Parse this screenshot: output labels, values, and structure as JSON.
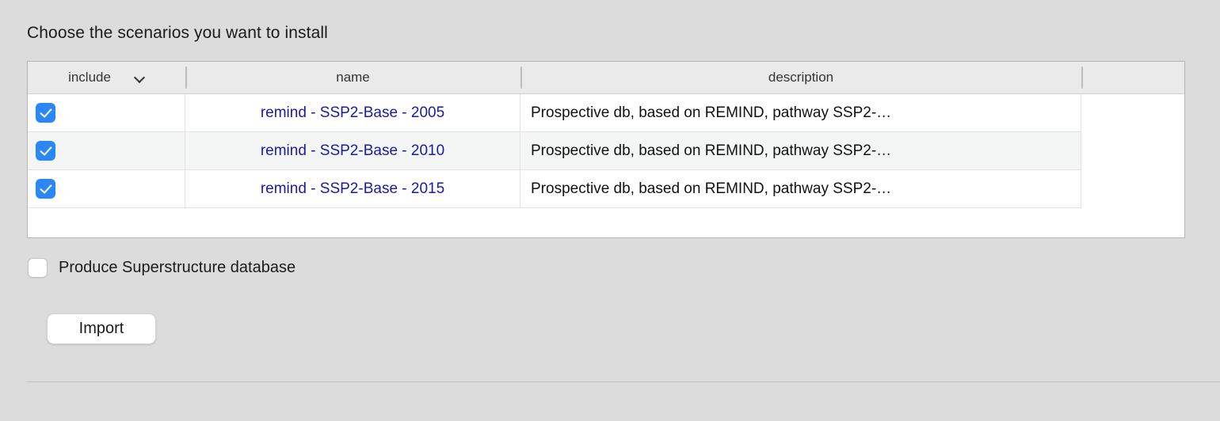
{
  "page": {
    "heading": "Choose the scenarios you want to install",
    "background_color": "#dcdcdc"
  },
  "table": {
    "columns": [
      {
        "key": "include",
        "label": "include",
        "sort_icon": "chevron-down-icon"
      },
      {
        "key": "name",
        "label": "name"
      },
      {
        "key": "description",
        "label": "description"
      },
      {
        "key": "extra",
        "label": ""
      }
    ],
    "rows": [
      {
        "include": true,
        "name": "remind - SSP2-Base - 2005",
        "description": "Prospective db, based on REMIND, pathway SSP2-…"
      },
      {
        "include": true,
        "name": "remind - SSP2-Base - 2010",
        "description": "Prospective db, based on REMIND, pathway SSP2-…"
      },
      {
        "include": true,
        "name": "remind - SSP2-Base - 2015",
        "description": "Prospective db, based on REMIND, pathway SSP2-…"
      }
    ],
    "link_color": "#1a1aa8",
    "header_background": "#eaeaea",
    "stripe_color": "#f4f5f5"
  },
  "options": {
    "superstructure": {
      "label": "Produce Superstructure database",
      "checked": false
    }
  },
  "actions": {
    "import_label": "Import"
  },
  "checkbox_accent": "#2b87f5"
}
